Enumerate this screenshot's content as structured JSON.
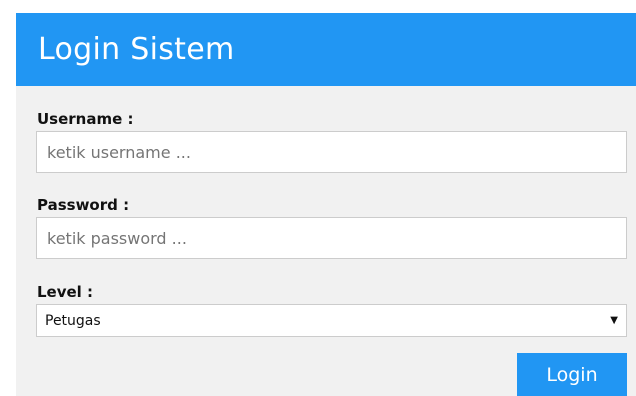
{
  "header": {
    "title": "Login Sistem"
  },
  "form": {
    "username": {
      "label": "Username :",
      "placeholder": "ketik username ..."
    },
    "password": {
      "label": "Password :",
      "placeholder": "ketik password ..."
    },
    "level": {
      "label": "Level :",
      "selected": "Petugas",
      "caret_icon": "caret-down-icon"
    },
    "submit_label": "Login"
  },
  "colors": {
    "accent": "#2196f3",
    "panel": "#f1f1f1"
  }
}
